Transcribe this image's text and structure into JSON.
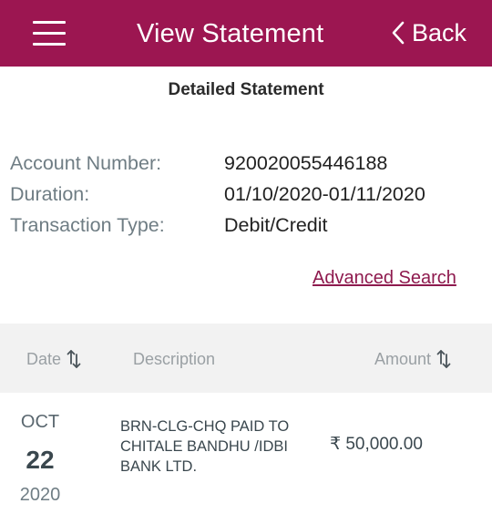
{
  "header": {
    "title": "View Statement",
    "back_label": "Back",
    "color": "#9c1651"
  },
  "statement": {
    "title": "Detailed Statement",
    "account": {
      "label": "Account Number:",
      "value": "920020055446188"
    },
    "duration": {
      "label": "Duration:",
      "value": "01/10/2020-01/11/2020"
    },
    "transaction_type": {
      "label": "Transaction Type:",
      "value": "Debit/Credit"
    },
    "advanced_search": "Advanced Search"
  },
  "table": {
    "columns": {
      "date": "Date",
      "description": "Description",
      "amount": "Amount"
    },
    "rows": [
      {
        "month": "OCT",
        "day": "22",
        "year": "2020",
        "description": "BRN-CLG-CHQ PAID TO CHITALE BANDHU /IDBI BANK LTD.",
        "amount": "₹ 50,000.00"
      }
    ]
  },
  "icons": [
    "menu-icon",
    "chevron-left-icon",
    "sort-icon"
  ]
}
